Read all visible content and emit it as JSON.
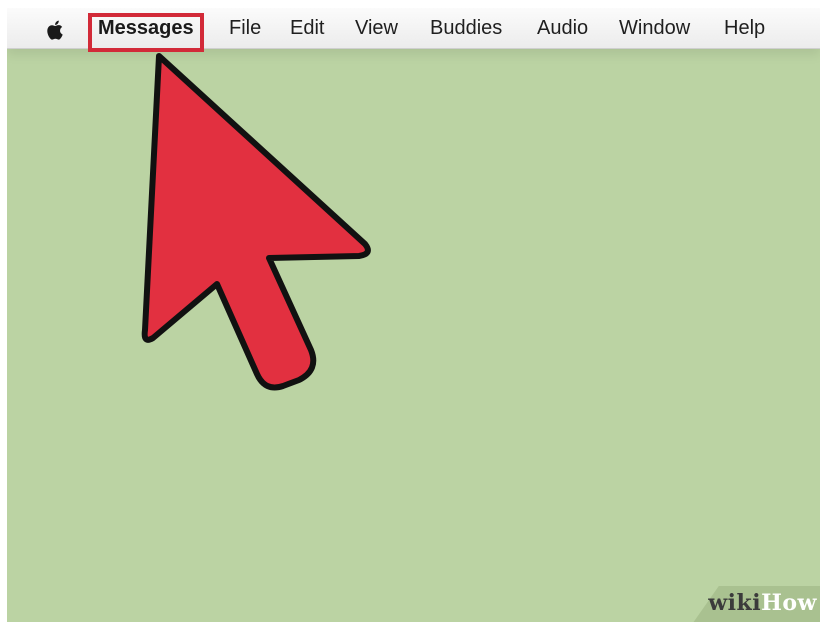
{
  "menubar": {
    "apple_icon": "apple-logo-icon",
    "items": [
      {
        "label": "Messages",
        "bold": true
      },
      {
        "label": "File"
      },
      {
        "label": "Edit"
      },
      {
        "label": "View"
      },
      {
        "label": "Buddies"
      },
      {
        "label": "Audio"
      },
      {
        "label": "Window"
      },
      {
        "label": "Help"
      }
    ]
  },
  "annotation": {
    "highlighted_item": "Messages",
    "highlight_color": "#d22a38",
    "arrow_color": "#e23040",
    "arrow_icon": "pointer-arrow-icon"
  },
  "background": {
    "desktop_color": "#bbd3a3"
  },
  "watermark": {
    "text_wiki": "wiki",
    "text_how": "How"
  }
}
